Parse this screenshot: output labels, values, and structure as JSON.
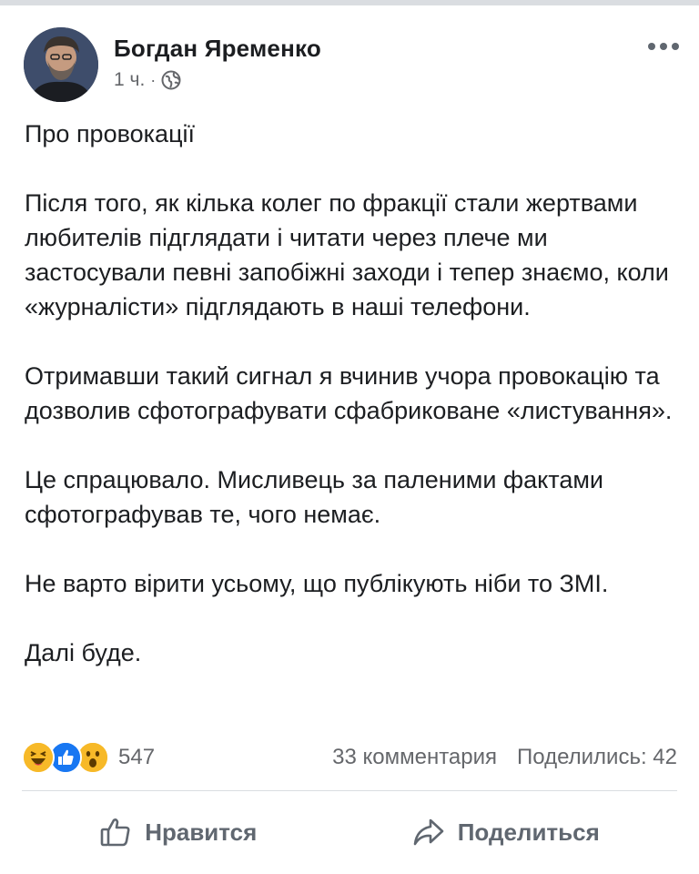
{
  "post": {
    "author": "Богдан Яременко",
    "time": "1 ч.",
    "separator": "·",
    "paragraphs": [
      "Про провокації",
      "Після того, як кілька колег по фракції стали жертвами любителів підглядати і читати через плече ми застосували певні запобіжні заходи і тепер знаємо, коли «журналісти» підглядають в наші телефони.",
      "Отримавши такий сигнал я вчинив учора провокацію та дозволив сфотографувати сфабриковане  «листування».",
      "Це спрацювало. Мисливець за паленими фактами сфотографував те, чого немає.",
      "Не варто вірити усьому, що публікують ніби то ЗМІ.",
      "Далі буде."
    ]
  },
  "stats": {
    "reaction_count": "547",
    "reactions": [
      "haha-icon",
      "like-icon",
      "wow-icon"
    ],
    "comments": "33 комментария",
    "shares": "Поделились: 42"
  },
  "actions": {
    "like_label": "Нравится",
    "share_label": "Поделиться"
  },
  "colors": {
    "like_blue": "#1877f2",
    "reaction_yellow": "#f7b928",
    "secondary_text": "#65676b"
  }
}
